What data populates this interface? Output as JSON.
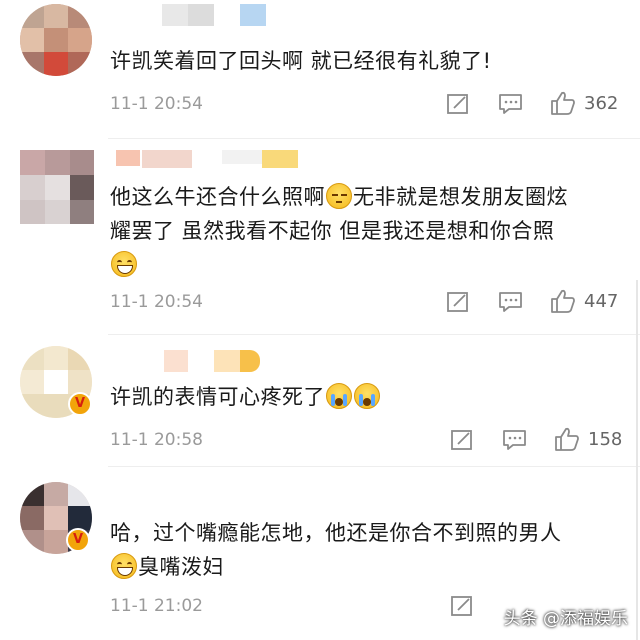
{
  "comments": [
    {
      "text": "许凯笑着回了回头啊 就已经很有礼貌了!",
      "time": "11-1 20:54",
      "likes": "362"
    },
    {
      "text_line1_a": "他这么牛还合什么照啊",
      "text_line1_b": "无非就是想发朋友圈炫",
      "text_line2": "耀罢了 虽然我看不起你 但是我还是想和你合照",
      "time": "11-1 20:54",
      "likes": "447"
    },
    {
      "text": "许凯的表情可心疼死了",
      "time": "11-1 20:58",
      "likes": "158"
    },
    {
      "text_line1": "哈，过个嘴瘾能怎地，他还是你合不到照的男人",
      "text_line2": "臭嘴泼妇",
      "time": "11-1 21:02",
      "likes": ""
    }
  ],
  "icons": {
    "edit": "edit-icon",
    "reply": "comment-icon",
    "like": "thumbs-up-icon"
  },
  "colors": {
    "meta_gray": "#9a9a9a",
    "badge_orange": "#f2a40a",
    "badge_red": "#d61f0f"
  },
  "watermark": "头条 @添福娱乐"
}
